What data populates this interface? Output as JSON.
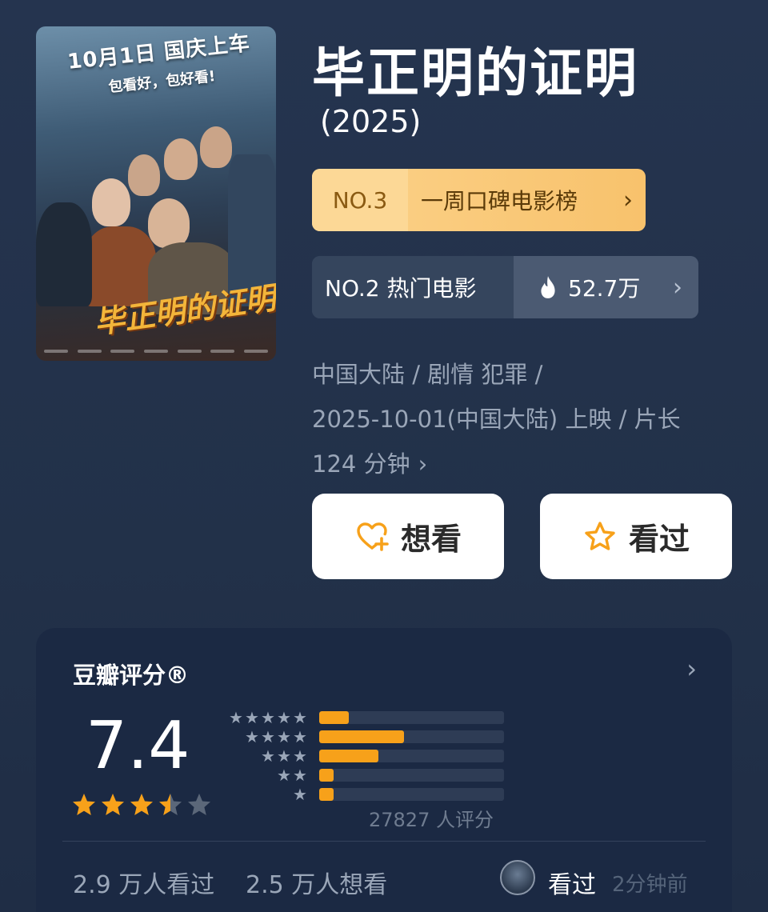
{
  "poster": {
    "banner_line1": "10月1日 国庆上车",
    "banner_line2": "包看好，包好看!",
    "title_art": "毕正明的证明"
  },
  "movie": {
    "title": "毕正明的证明",
    "year": "(2025)"
  },
  "rank_gold": {
    "number": "NO.3",
    "label": "一周口碑电影榜",
    "chevron": "›"
  },
  "rank_hot": {
    "label": "NO.2 热门电影",
    "heat": "52.7万",
    "chevron": "›",
    "icon": "flame-icon"
  },
  "meta": {
    "line1": "中国大陆 / 剧情 犯罪 /",
    "line2": "2025-10-01(中国大陆) 上映 / 片长",
    "line3": "124 分钟",
    "chevron": "›"
  },
  "actions": {
    "want_label": "想看",
    "seen_label": "看过"
  },
  "rating": {
    "title": "豆瓣评分®",
    "chevron": "›",
    "score": "7.4",
    "stars_filled": 3.5,
    "stars_total": 5,
    "distribution": [
      {
        "stars": 5,
        "fraction": 0.16
      },
      {
        "stars": 4,
        "fraction": 0.46
      },
      {
        "stars": 3,
        "fraction": 0.32
      },
      {
        "stars": 2,
        "fraction": 0.08
      },
      {
        "stars": 1,
        "fraction": 0.08
      }
    ],
    "count_text": "27827 人评分",
    "seen_text": "2.9 万人看过",
    "want_text": "2.5 万人想看",
    "friend_action": "看过",
    "friend_time": "2分钟前"
  },
  "colors": {
    "background": "#25344f",
    "accent_orange": "#f7a11a",
    "gold_badge": "#fbd28a",
    "card": "#1b2943"
  }
}
